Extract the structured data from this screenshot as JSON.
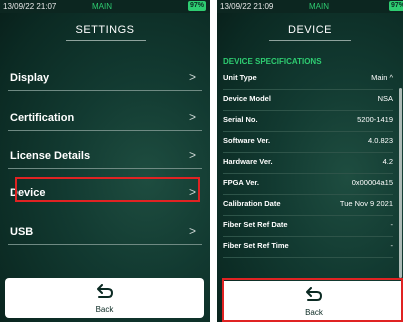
{
  "left": {
    "status": {
      "time": "13/09/22 21:07",
      "mode": "MAIN",
      "battery": "97%"
    },
    "title": "SETTINGS",
    "menu": [
      {
        "label": "Display",
        "chevron": ">"
      },
      {
        "label": "Certification",
        "chevron": ">"
      },
      {
        "label": "License Details",
        "chevron": ">"
      },
      {
        "label": "Device",
        "chevron": ">"
      },
      {
        "label": "USB",
        "chevron": ">"
      }
    ],
    "back_label": "Back"
  },
  "right": {
    "status": {
      "time": "13/09/22 21:09",
      "mode": "MAIN",
      "battery": "97%"
    },
    "title": "DEVICE",
    "section": "DEVICE SPECIFICATIONS",
    "rows": [
      {
        "key": "Unit Type",
        "value": "Main ^"
      },
      {
        "key": "Device Model",
        "value": "NSA"
      },
      {
        "key": "Serial No.",
        "value": "5200-1419"
      },
      {
        "key": "Software Ver.",
        "value": "4.0.823"
      },
      {
        "key": "Hardware Ver.",
        "value": "4.2"
      },
      {
        "key": "FPGA Ver.",
        "value": "0x00004a15"
      },
      {
        "key": "Calibration Date",
        "value": "Tue Nov 9 2021"
      },
      {
        "key": "Fiber Set Ref Date",
        "value": "-"
      },
      {
        "key": "Fiber Set Ref Time",
        "value": "-"
      }
    ],
    "back_label": "Back"
  },
  "colors": {
    "highlight": "#e02323",
    "accent": "#2ecc71"
  }
}
